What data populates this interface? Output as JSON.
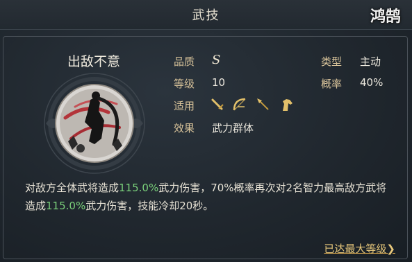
{
  "header": {
    "title": "武技",
    "logo_text": "鸿鹄"
  },
  "skill": {
    "name": "出敌不意",
    "quality_label": "品质",
    "quality_value": "S",
    "level_label": "等级",
    "level_value": "10",
    "applicable_label": "适用",
    "applicable_weapons": [
      "sword-icon",
      "bow-icon",
      "spear-icon",
      "horse-icon"
    ],
    "effect_label": "效果",
    "effect_value": "武力群体",
    "type_label": "类型",
    "type_value": "主动",
    "chance_label": "概率",
    "chance_value": "40%"
  },
  "description": {
    "part1": "对敌方全体武将造成",
    "pct1": "115.0%",
    "part2": "武力伤害，70%概率再次对2名智力最高敌方武将造成",
    "pct2": "115.0%",
    "part3": "武力伤害，技能冷却20秒。"
  },
  "footer": {
    "max_level_link": "已达最大等级❯"
  },
  "colors": {
    "highlight": "#7ad07a",
    "label": "#d8c39a",
    "link": "#e7c77b"
  }
}
